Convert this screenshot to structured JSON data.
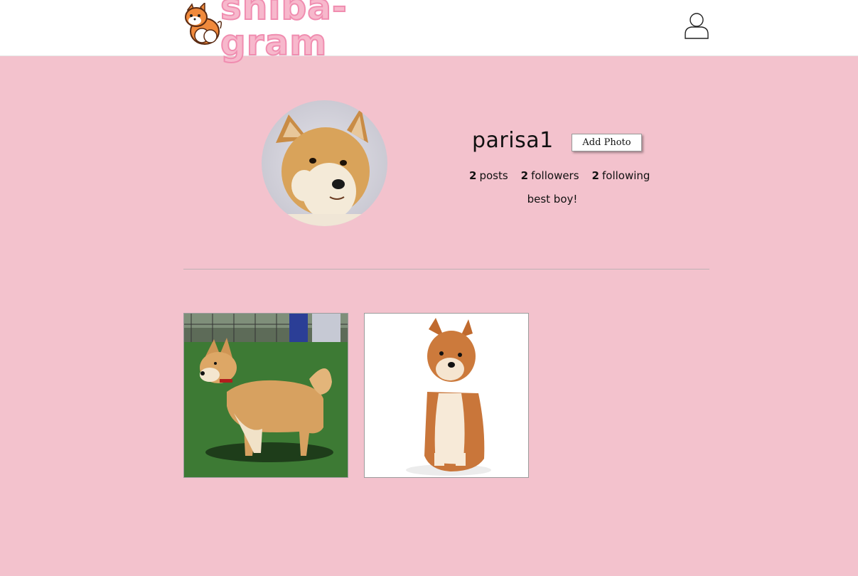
{
  "app": {
    "logo_text": "shiba-gram",
    "background_color": "#f3c2cd",
    "accent_color": "#f7b8cc"
  },
  "header": {
    "logo_icon": "shiba-mascot-icon",
    "profile_icon": "user-profile-icon"
  },
  "profile": {
    "username": "parisa1",
    "add_photo_label": "Add Photo",
    "posts_count": "2",
    "posts_label": "posts",
    "followers_count": "2",
    "followers_label": "followers",
    "following_count": "2",
    "following_label": "following",
    "bio": "best boy!",
    "avatar": "shiba-face-photo"
  },
  "posts": [
    {
      "image": "shiba-standing-on-grass-photo"
    },
    {
      "image": "shiba-sitting-white-background-photo"
    }
  ]
}
